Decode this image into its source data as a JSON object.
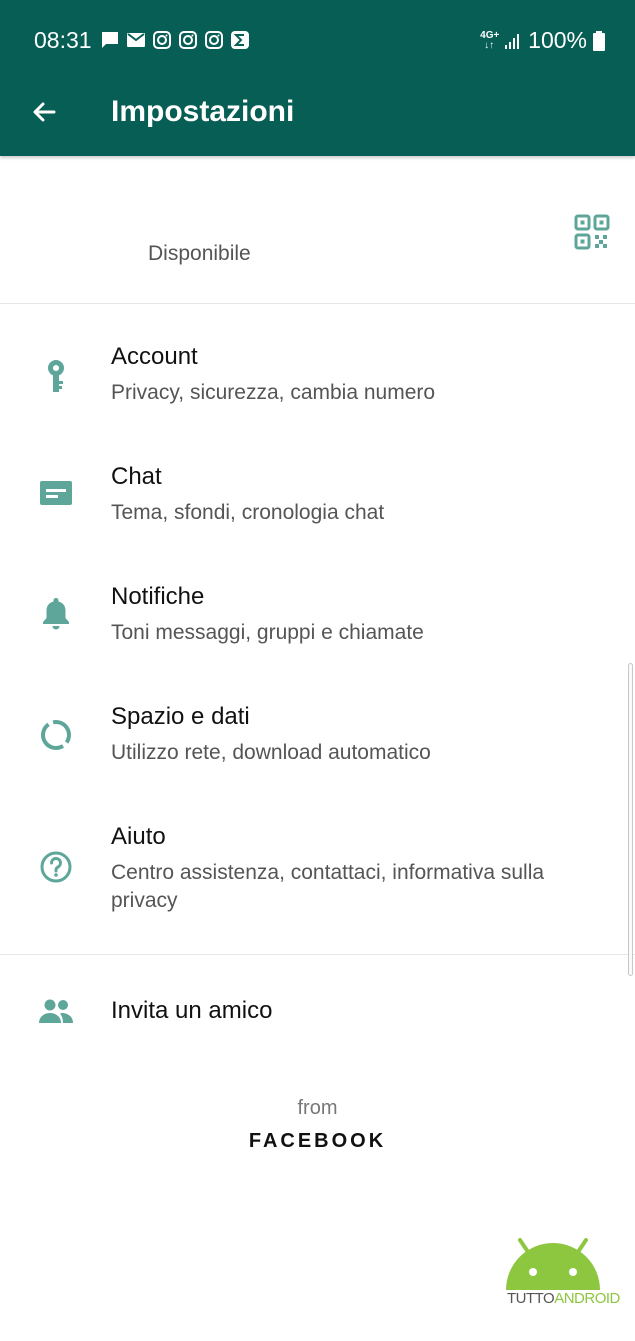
{
  "status_bar": {
    "time": "08:31",
    "network": "4G+",
    "battery": "100%",
    "notification_icons": [
      "message-icon",
      "mail-icon",
      "instagram-icon",
      "instagram-icon",
      "instagram-icon",
      "sigma-icon"
    ]
  },
  "toolbar": {
    "title": "Impostazioni",
    "back_icon": "arrow-left-icon"
  },
  "profile": {
    "status": "Disponibile",
    "qr_icon": "qr-code-icon"
  },
  "menu": [
    {
      "title": "Account",
      "subtitle": "Privacy, sicurezza, cambia numero",
      "icon": "key-icon"
    },
    {
      "title": "Chat",
      "subtitle": "Tema, sfondi, cronologia chat",
      "icon": "chat-icon"
    },
    {
      "title": "Notifiche",
      "subtitle": "Toni messaggi, gruppi e chiamate",
      "icon": "bell-icon"
    },
    {
      "title": "Spazio e dati",
      "subtitle": "Utilizzo rete, download automatico",
      "icon": "data-usage-icon"
    },
    {
      "title": "Aiuto",
      "subtitle": "Centro assistenza, contattaci, informativa sulla privacy",
      "icon": "help-icon"
    }
  ],
  "invite": {
    "label": "Invita un amico",
    "icon": "people-icon"
  },
  "footer": {
    "from": "from",
    "brand": "FACEBOOK"
  },
  "watermark": {
    "text_part1": "TUTTO",
    "text_part2": "ANDROID"
  },
  "colors": {
    "primary": "#075e54",
    "icon": "#5fa69a",
    "watermark_green": "#8dc63f"
  }
}
